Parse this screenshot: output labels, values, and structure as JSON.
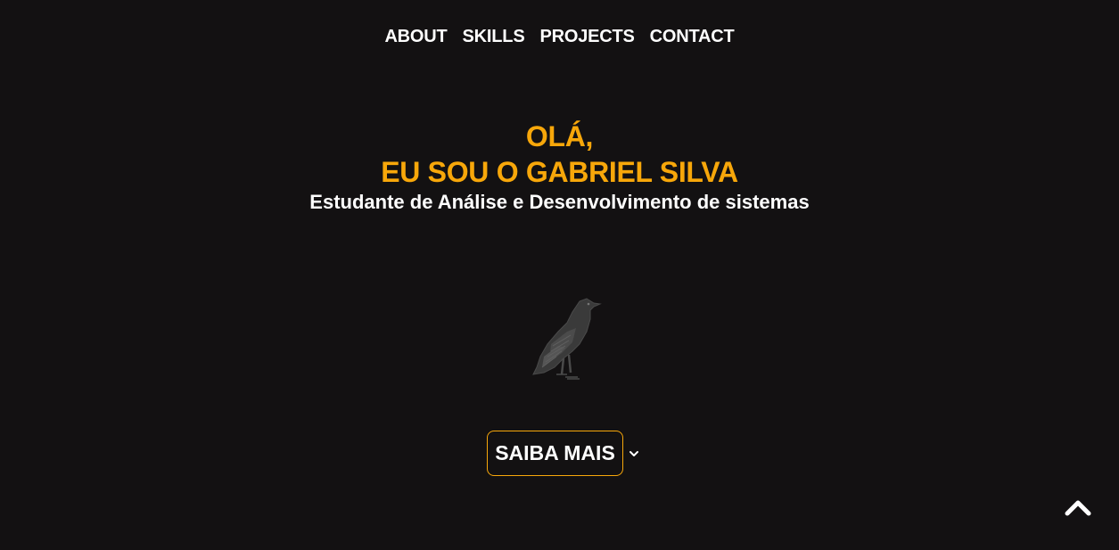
{
  "nav": {
    "items": [
      {
        "label": "ABOUT"
      },
      {
        "label": "SKILLS"
      },
      {
        "label": "PROJECTS"
      },
      {
        "label": "CONTACT"
      }
    ]
  },
  "hero": {
    "greeting": "OLÁ,",
    "name": "EU SOU O GABRIEL SILVA",
    "subtitle": "Estudante de Análise e Desenvolvimento de sistemas"
  },
  "illustration": {
    "icon": "crow-icon"
  },
  "cta": {
    "label": "SAIBA MAIS",
    "icon": "chevron-down-icon"
  },
  "scroll_top": {
    "icon": "chevron-up-icon"
  },
  "colors": {
    "background": "#131112",
    "accent": "#f7a70a",
    "text": "#ffffff"
  }
}
